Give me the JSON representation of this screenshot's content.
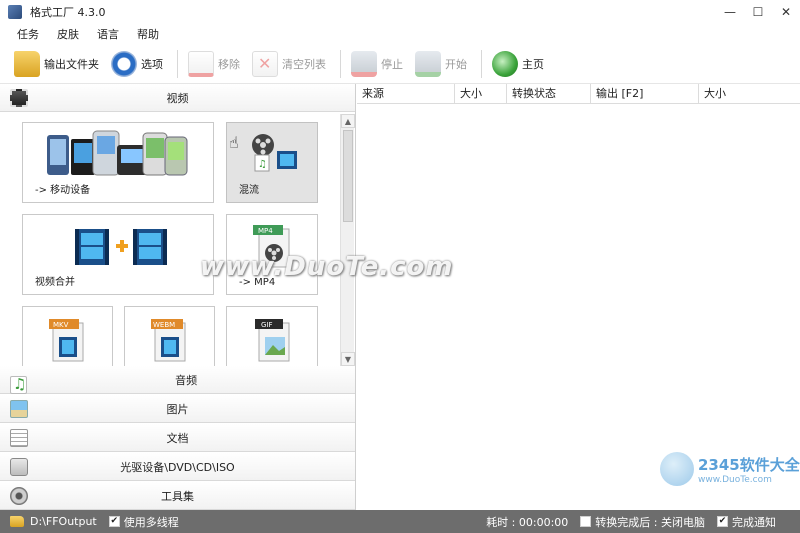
{
  "window": {
    "title": "格式工厂 4.3.0",
    "minimize": "—",
    "maximize": "☐",
    "close": "✕"
  },
  "menu": [
    "任务",
    "皮肤",
    "语言",
    "帮助"
  ],
  "toolbar": {
    "output_folder": "输出文件夹",
    "options": "选项",
    "remove": "移除",
    "clear_list": "清空列表",
    "stop": "停止",
    "start": "开始",
    "home": "主页"
  },
  "categories": {
    "video": "视频",
    "audio": "音频",
    "picture": "图片",
    "document": "文档",
    "disc": "光驱设备\\DVD\\CD\\ISO",
    "tools": "工具集"
  },
  "video_tiles": {
    "mobile": "-> 移动设备",
    "mux": "混流",
    "merge": "视频合并",
    "mp4": "-> MP4",
    "mp4_badge": "MP4",
    "mkv_badge": "MKV",
    "webm_badge": "WEBM",
    "gif_badge": "GIF"
  },
  "columns": [
    "来源",
    "大小",
    "转换状态",
    "输出 [F2]",
    "大小"
  ],
  "statusbar": {
    "output_path": "D:\\FFOutput",
    "multithread": "使用多线程",
    "elapsed_label": "耗时 : 00:00:00",
    "after_convert": "转换完成后 : 关闭电脑",
    "notify": "完成通知"
  },
  "watermark": {
    "site": "www.DuoTe.com",
    "brand": "2345软件大全",
    "brand_url": "www.DuoTe.com"
  },
  "colors": {
    "statusbar_bg": "#6d6d6d",
    "tile_hover": "#e3e3e3"
  }
}
